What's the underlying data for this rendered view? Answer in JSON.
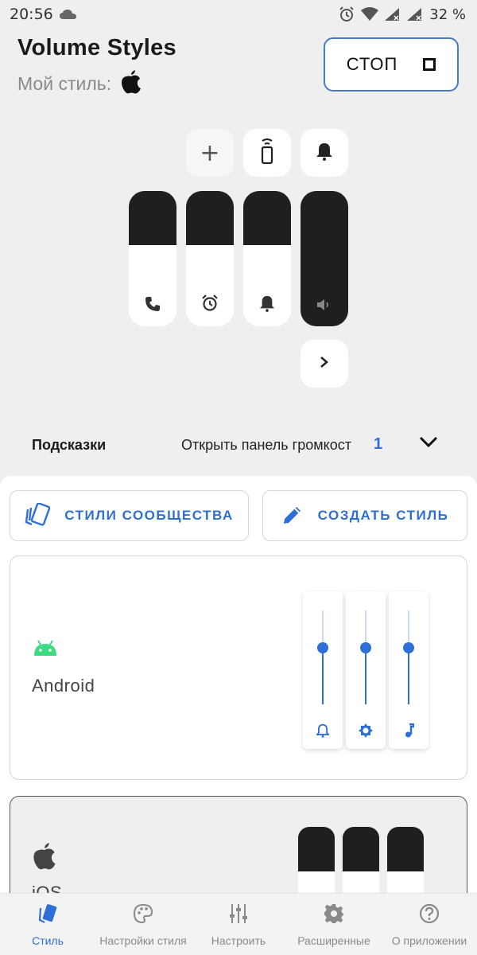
{
  "status_bar": {
    "time": "20:56",
    "battery": "32 %"
  },
  "header": {
    "title": "Volume Styles",
    "style_label": "Мой стиль:",
    "stop_label": "СТОП"
  },
  "preview": {
    "sliders": [
      {
        "name": "call",
        "level": 0.4
      },
      {
        "name": "alarm",
        "level": 0.4
      },
      {
        "name": "notification",
        "level": 0.4
      },
      {
        "name": "media",
        "level": 1.0
      }
    ]
  },
  "hints": {
    "label": "Подсказки",
    "text": "Открыть панель громкости",
    "count": "1"
  },
  "actions": {
    "community_label": "СТИЛИ СООБЩЕСТВА",
    "create_label": "СОЗДАТЬ СТИЛЬ"
  },
  "styles": [
    {
      "name": "Android",
      "levels": [
        0.6,
        0.6,
        0.6
      ]
    },
    {
      "name": "iOS",
      "levels": [
        0.55,
        0.55,
        0.55
      ]
    }
  ],
  "nav": [
    {
      "label": "Стиль",
      "active": true
    },
    {
      "label": "Настройки стиля",
      "active": false
    },
    {
      "label": "Настроить",
      "active": false
    },
    {
      "label": "Расширенные",
      "active": false
    },
    {
      "label": "О приложении",
      "active": false
    }
  ],
  "colors": {
    "accent": "#2d6fd6",
    "android_green": "#3ddc84",
    "slider_dark": "#1f1f1f"
  }
}
